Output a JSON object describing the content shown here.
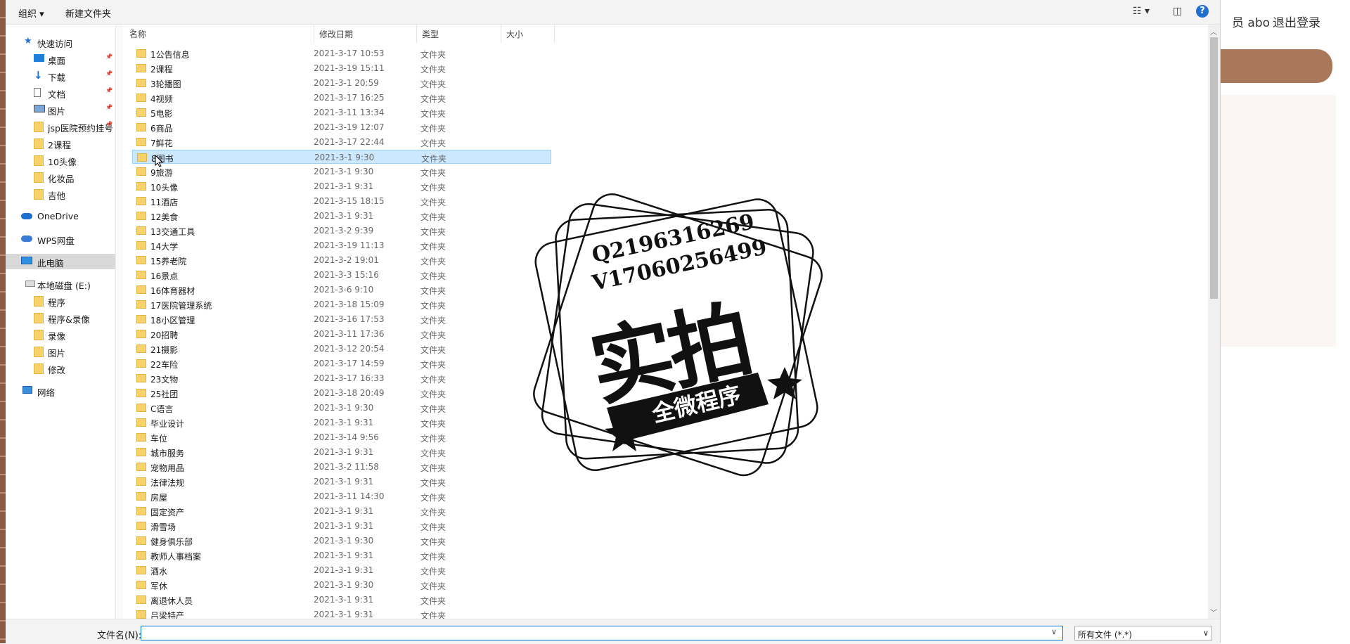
{
  "background_page": {
    "header_user": "员 abo",
    "logout": "退出登录"
  },
  "toolbar": {
    "organize": "组织 ▾",
    "new_folder": "新建文件夹",
    "view_icon": "view-list-icon",
    "pane_icon": "preview-pane-icon",
    "help_icon": "help-icon",
    "help_label": "?"
  },
  "nav": {
    "quick_access": "快速访问",
    "pinned": [
      {
        "label": "桌面",
        "icon": "desktop-icon"
      },
      {
        "label": "下载",
        "icon": "download-icon"
      },
      {
        "label": "文档",
        "icon": "document-icon"
      },
      {
        "label": "图片",
        "icon": "pictures-icon"
      },
      {
        "label": "jsp医院预约挂号",
        "icon": "folder-icon"
      }
    ],
    "recent": [
      "2课程",
      "10头像",
      "化妆品",
      "吉他"
    ],
    "onedrive": "OneDrive",
    "wps": "WPS网盘",
    "this_pc": "此电脑",
    "local_disk": "本地磁盘 (E:)",
    "disk_folders": [
      "程序",
      "程序&录像",
      "录像",
      "图片",
      "修改"
    ],
    "network": "网络"
  },
  "columns": {
    "name": "名称",
    "date": "修改日期",
    "type": "类型",
    "size": "大小"
  },
  "files": [
    {
      "name": "1公告信息",
      "date": "2021-3-17 10:53",
      "type": "文件夹"
    },
    {
      "name": "2课程",
      "date": "2021-3-19 15:11",
      "type": "文件夹"
    },
    {
      "name": "3轮播图",
      "date": "2021-3-1 20:59",
      "type": "文件夹"
    },
    {
      "name": "4视频",
      "date": "2021-3-17 16:25",
      "type": "文件夹"
    },
    {
      "name": "5电影",
      "date": "2021-3-11 13:34",
      "type": "文件夹"
    },
    {
      "name": "6商品",
      "date": "2021-3-19 12:07",
      "type": "文件夹"
    },
    {
      "name": "7鲜花",
      "date": "2021-3-17 22:44",
      "type": "文件夹"
    },
    {
      "name": "8图书",
      "date": "2021-3-1 9:30",
      "type": "文件夹",
      "selected": true
    },
    {
      "name": "9旅游",
      "date": "2021-3-1 9:30",
      "type": "文件夹"
    },
    {
      "name": "10头像",
      "date": "2021-3-1 9:31",
      "type": "文件夹"
    },
    {
      "name": "11酒店",
      "date": "2021-3-15 18:15",
      "type": "文件夹"
    },
    {
      "name": "12美食",
      "date": "2021-3-1 9:31",
      "type": "文件夹"
    },
    {
      "name": "13交通工具",
      "date": "2021-3-2 9:39",
      "type": "文件夹"
    },
    {
      "name": "14大学",
      "date": "2021-3-19 11:13",
      "type": "文件夹"
    },
    {
      "name": "15养老院",
      "date": "2021-3-2 19:01",
      "type": "文件夹"
    },
    {
      "name": "16景点",
      "date": "2021-3-3 15:16",
      "type": "文件夹"
    },
    {
      "name": "16体育器材",
      "date": "2021-3-6 9:10",
      "type": "文件夹"
    },
    {
      "name": "17医院管理系统",
      "date": "2021-3-18 15:09",
      "type": "文件夹"
    },
    {
      "name": "18小区管理",
      "date": "2021-3-16 17:53",
      "type": "文件夹"
    },
    {
      "name": "20招聘",
      "date": "2021-3-11 17:36",
      "type": "文件夹"
    },
    {
      "name": "21摄影",
      "date": "2021-3-12 20:54",
      "type": "文件夹"
    },
    {
      "name": "22车险",
      "date": "2021-3-17 14:59",
      "type": "文件夹"
    },
    {
      "name": "23文物",
      "date": "2021-3-17 16:33",
      "type": "文件夹"
    },
    {
      "name": "25社团",
      "date": "2021-3-18 20:49",
      "type": "文件夹"
    },
    {
      "name": "C语言",
      "date": "2021-3-1 9:30",
      "type": "文件夹"
    },
    {
      "name": "毕业设计",
      "date": "2021-3-1 9:31",
      "type": "文件夹"
    },
    {
      "name": "车位",
      "date": "2021-3-14 9:56",
      "type": "文件夹"
    },
    {
      "name": "城市服务",
      "date": "2021-3-1 9:31",
      "type": "文件夹"
    },
    {
      "name": "宠物用品",
      "date": "2021-3-2 11:58",
      "type": "文件夹"
    },
    {
      "name": "法律法规",
      "date": "2021-3-1 9:31",
      "type": "文件夹"
    },
    {
      "name": "房屋",
      "date": "2021-3-11 14:30",
      "type": "文件夹"
    },
    {
      "name": "固定资产",
      "date": "2021-3-1 9:31",
      "type": "文件夹"
    },
    {
      "name": "滑雪场",
      "date": "2021-3-1 9:31",
      "type": "文件夹"
    },
    {
      "name": "健身俱乐部",
      "date": "2021-3-1 9:30",
      "type": "文件夹"
    },
    {
      "name": "教师人事档案",
      "date": "2021-3-1 9:31",
      "type": "文件夹"
    },
    {
      "name": "酒水",
      "date": "2021-3-1 9:31",
      "type": "文件夹"
    },
    {
      "name": "军休",
      "date": "2021-3-1 9:30",
      "type": "文件夹"
    },
    {
      "name": "离退休人员",
      "date": "2021-3-1 9:31",
      "type": "文件夹"
    },
    {
      "name": "吕梁特产",
      "date": "2021-3-1 9:31",
      "type": "文件夹"
    }
  ],
  "bottom": {
    "filename_label": "文件名(N):",
    "filename_value": "",
    "filetype": "所有文件 (*.*)"
  },
  "watermark": {
    "line1": "Q2196316269",
    "line2": "V17060256499",
    "main": "实拍",
    "banner": "全微程序"
  },
  "colors": {
    "selection": "#cce8ff",
    "accent": "#0078d7",
    "bg_brown": "#a9785a"
  }
}
